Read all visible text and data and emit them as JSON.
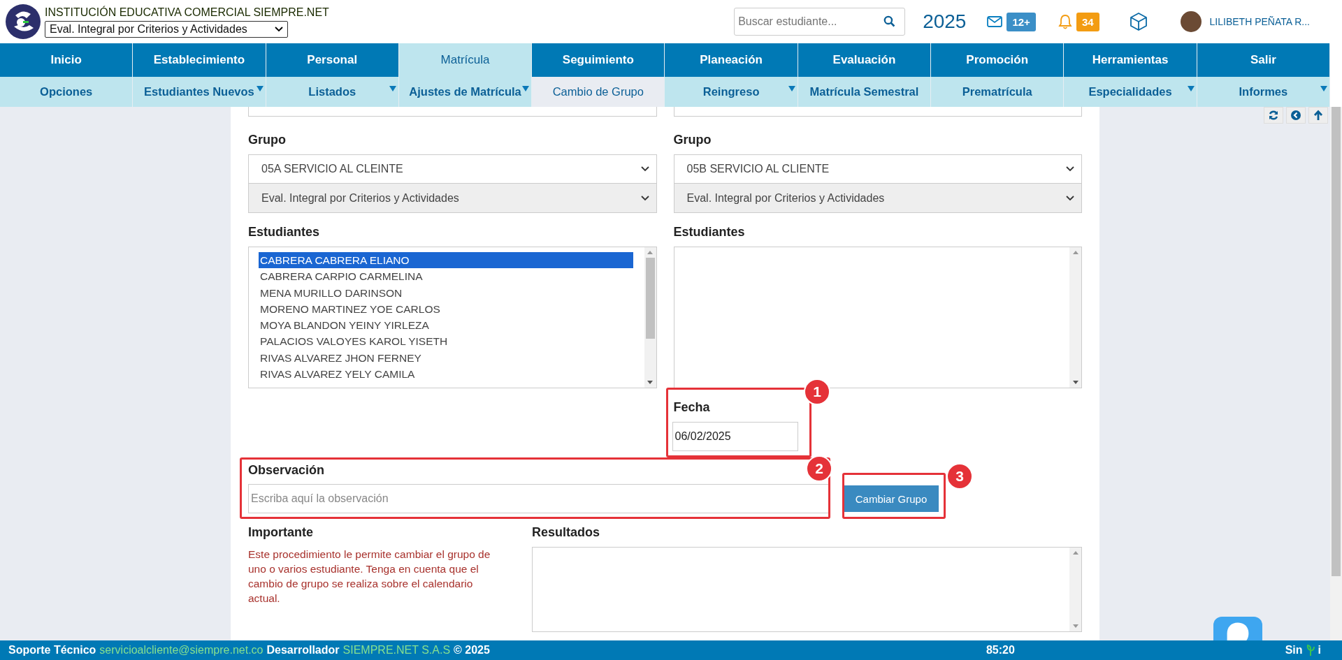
{
  "header": {
    "institution": "INSTITUCIÓN EDUCATIVA COMERCIAL SIEMPRE.NET",
    "calendar_select": "Eval. Integral por Criterios y Actividades",
    "search": {
      "placeholder": "Buscar estudiante..."
    },
    "year": "2025",
    "messages_badge": "12+",
    "notifications_badge": "34",
    "user_name": "LILIBETH PEÑATA R..."
  },
  "nav": {
    "main": [
      {
        "label": "Inicio",
        "selected": false
      },
      {
        "label": "Establecimiento",
        "selected": false
      },
      {
        "label": "Personal",
        "selected": false
      },
      {
        "label": "Matrícula",
        "selected": true
      },
      {
        "label": "Seguimiento",
        "selected": false
      },
      {
        "label": "Planeación",
        "selected": false
      },
      {
        "label": "Evaluación",
        "selected": false
      },
      {
        "label": "Promoción",
        "selected": false
      },
      {
        "label": "Herramientas",
        "selected": false
      },
      {
        "label": "Salir",
        "selected": false
      }
    ],
    "sub": [
      {
        "label": "Opciones",
        "selected": false,
        "dropdown": false
      },
      {
        "label": "Estudiantes Nuevos",
        "selected": false,
        "dropdown": true
      },
      {
        "label": "Listados",
        "selected": false,
        "dropdown": true
      },
      {
        "label": "Ajustes de Matrícula",
        "selected": false,
        "dropdown": true
      },
      {
        "label": "Cambio de Grupo",
        "selected": true,
        "dropdown": false
      },
      {
        "label": "Reingreso",
        "selected": false,
        "dropdown": true
      },
      {
        "label": "Matrícula Semestral",
        "selected": false,
        "dropdown": false
      },
      {
        "label": "Prematrícula",
        "selected": false,
        "dropdown": false
      },
      {
        "label": "Especialidades",
        "selected": false,
        "dropdown": true
      },
      {
        "label": "Informes",
        "selected": false,
        "dropdown": true
      }
    ]
  },
  "form": {
    "source": {
      "group_label": "Grupo",
      "group": "05A SERVICIO AL CLEINTE",
      "calendar": "Eval. Integral por Criterios y Actividades",
      "students_label": "Estudiantes",
      "students": [
        {
          "name": "CABRERA CABRERA ELIANO",
          "selected": true
        },
        {
          "name": "CABRERA CARPIO CARMELINA",
          "selected": false
        },
        {
          "name": "MENA MURILLO DARINSON",
          "selected": false
        },
        {
          "name": "MORENO MARTINEZ YOE CARLOS",
          "selected": false
        },
        {
          "name": "MOYA BLANDON YEINY YIRLEZA",
          "selected": false
        },
        {
          "name": "PALACIOS VALOYES KAROL YISETH",
          "selected": false
        },
        {
          "name": "RIVAS ALVAREZ JHON FERNEY",
          "selected": false
        },
        {
          "name": "RIVAS ALVAREZ YELY CAMILA",
          "selected": false
        }
      ]
    },
    "target": {
      "group_label": "Grupo",
      "group": "05B SERVICIO AL CLIENTE",
      "calendar": "Eval. Integral por Criterios y Actividades",
      "students_label": "Estudiantes"
    },
    "date_label": "Fecha",
    "date": "06/02/2025",
    "observation_label": "Observación",
    "observation": {
      "placeholder": "Escriba aquí la observación"
    },
    "submit": "Cambiar Grupo",
    "important_label": "Importante",
    "important_text": "Este procedimiento le permite cambiar el grupo de uno o varios estudiante. Tenga en cuenta que el cambio de grupo se realiza sobre el calendario actual.",
    "results_label": "Resultados"
  },
  "annotations": [
    {
      "number": "1"
    },
    {
      "number": "2"
    },
    {
      "number": "3"
    }
  ],
  "footer": {
    "support_label": "Soporte Técnico",
    "support_email": "servicioalcliente@siempre.net.co",
    "developer_label": "Desarrollador",
    "developer": "SIEMPRE.NET S.A.S",
    "copyright": "© 2025",
    "time": "85:20",
    "logo_start": "Sin",
    "logo_end": "i"
  }
}
